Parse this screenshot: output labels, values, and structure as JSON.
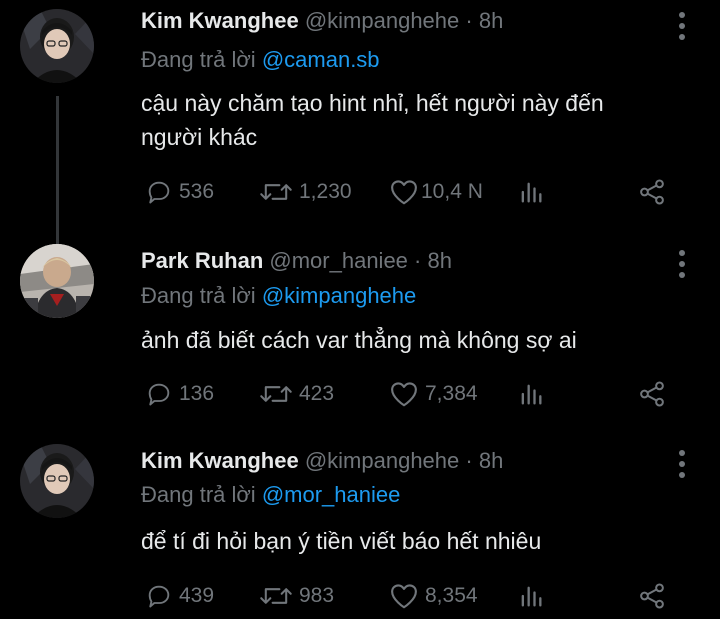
{
  "colors": {
    "background": "#000000",
    "text": "#e7e9ea",
    "muted": "#71767b",
    "link": "#1d9bf0"
  },
  "reply_prefix": "Đang trả lời",
  "tweets": [
    {
      "name": "Kim Kwanghee",
      "handle": "@kimpanghehe",
      "sep": "·",
      "time": "8h",
      "reply_to": "@caman.sb",
      "text_lines": [
        "cậu này chăm tạo hint nhỉ, hết người này đến",
        "người khác"
      ],
      "replies": "536",
      "retweets": "1,230",
      "likes": "10,4 N",
      "icons": [
        "reply-icon",
        "retweet-icon",
        "like-icon",
        "analytics-icon",
        "share-icon"
      ]
    },
    {
      "name": "Park Ruhan",
      "handle": "@mor_haniee",
      "sep": "·",
      "time": "8h",
      "reply_to": "@kimpanghehe",
      "text_lines": [
        "ảnh đã biết cách var thẳng mà không sợ ai"
      ],
      "replies": "136",
      "retweets": "423",
      "likes": "7,384",
      "icons": [
        "reply-icon",
        "retweet-icon",
        "like-icon",
        "analytics-icon",
        "share-icon"
      ]
    },
    {
      "name": "Kim Kwanghee",
      "handle": "@kimpanghehe",
      "sep": "·",
      "time": "8h",
      "reply_to": "@mor_haniee",
      "text_lines": [
        "để tí đi hỏi bạn ý tiền viết báo hết nhiêu"
      ],
      "replies": "439",
      "retweets": "983",
      "likes": "8,354",
      "icons": [
        "reply-icon",
        "retweet-icon",
        "like-icon",
        "analytics-icon",
        "share-icon"
      ]
    }
  ]
}
